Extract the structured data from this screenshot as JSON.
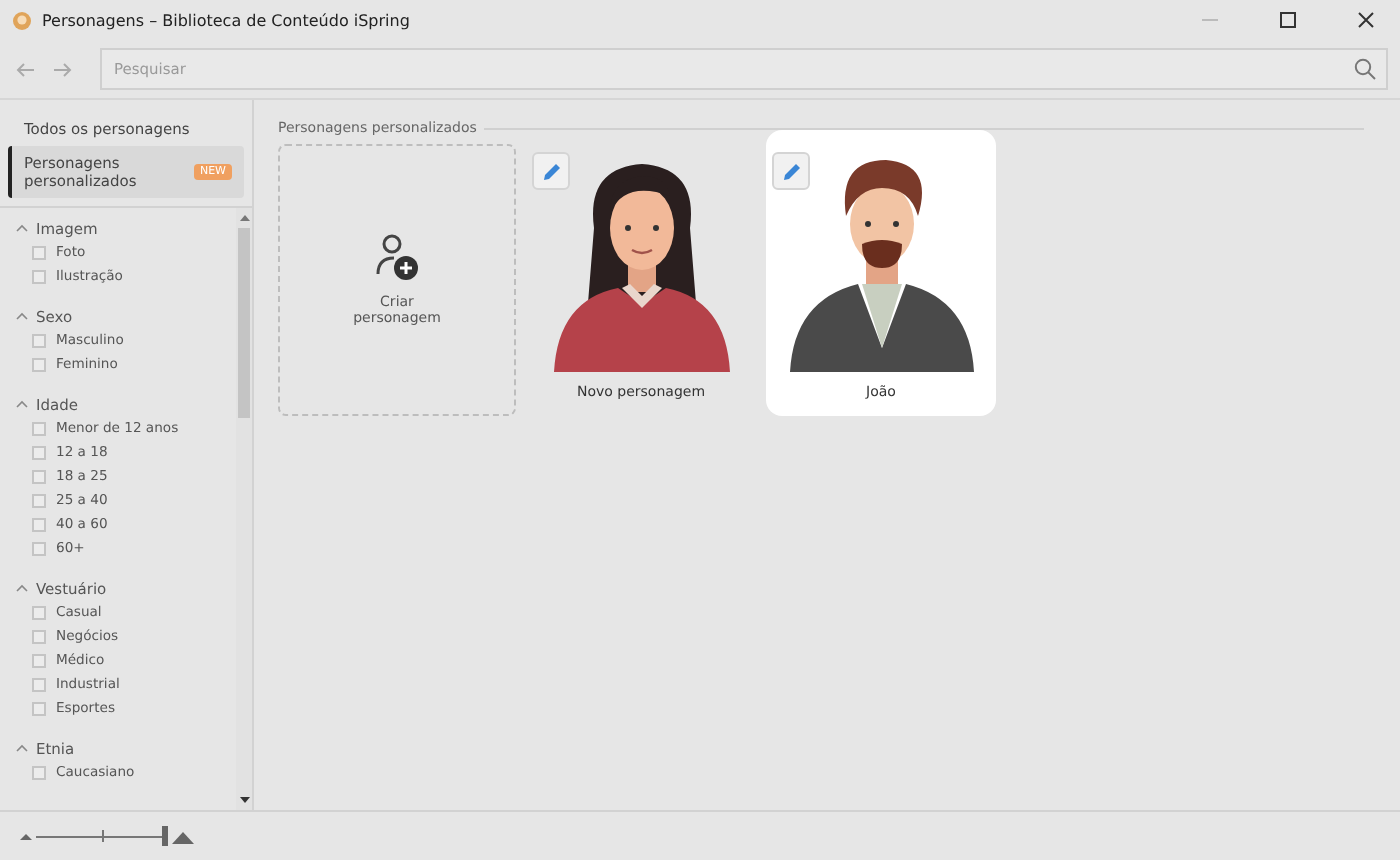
{
  "window": {
    "title": "Personagens – Biblioteca de Conteúdo iSpring"
  },
  "search": {
    "placeholder": "Pesquisar"
  },
  "sidebar": {
    "items": [
      {
        "label": "Todos os personagens",
        "selected": false
      },
      {
        "label": "Personagens personalizados",
        "badge": "NEW",
        "selected": true
      }
    ],
    "filters": [
      {
        "title": "Imagem",
        "expanded": true,
        "options": [
          {
            "label": "Foto",
            "checked": false
          },
          {
            "label": "Ilustração",
            "checked": false
          }
        ]
      },
      {
        "title": "Sexo",
        "expanded": true,
        "options": [
          {
            "label": "Masculino",
            "checked": false
          },
          {
            "label": "Feminino",
            "checked": false
          }
        ]
      },
      {
        "title": "Idade",
        "expanded": true,
        "options": [
          {
            "label": "Menor de 12 anos",
            "checked": false
          },
          {
            "label": "12 a 18",
            "checked": false
          },
          {
            "label": "18 a 25",
            "checked": false
          },
          {
            "label": "25 a 40",
            "checked": false
          },
          {
            "label": "40 a 60",
            "checked": false
          },
          {
            "label": "60+",
            "checked": false
          }
        ]
      },
      {
        "title": "Vestuário",
        "expanded": true,
        "options": [
          {
            "label": "Casual",
            "checked": false
          },
          {
            "label": "Negócios",
            "checked": false
          },
          {
            "label": "Médico",
            "checked": false
          },
          {
            "label": "Industrial",
            "checked": false
          },
          {
            "label": "Esportes",
            "checked": false
          }
        ]
      },
      {
        "title": "Etnia",
        "expanded": true,
        "options": [
          {
            "label": "Caucasiano",
            "checked": false
          }
        ]
      }
    ]
  },
  "section": {
    "title": "Personagens personalizados",
    "create_label": "Criar personagem",
    "characters": [
      {
        "name": "Novo personagem",
        "kind": "female",
        "selected": false
      },
      {
        "name": "João",
        "kind": "male",
        "selected": true
      }
    ]
  },
  "zoom": {
    "level": 0.98
  }
}
